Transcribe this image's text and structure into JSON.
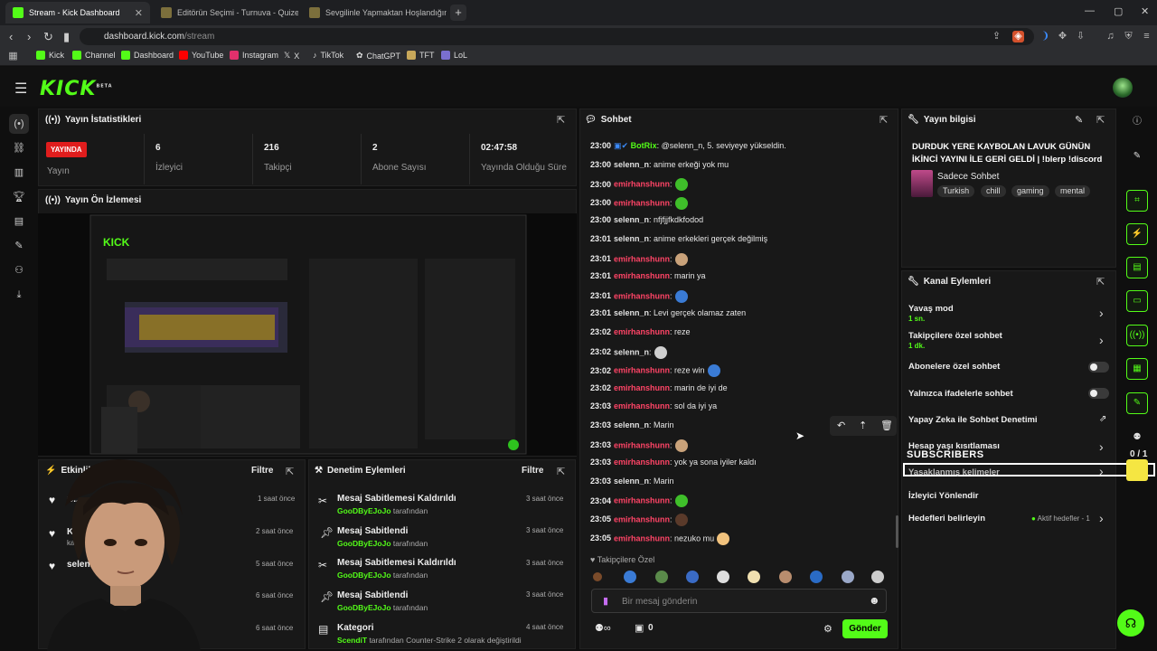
{
  "browser": {
    "tabs": [
      {
        "title": "Stream - Kick Dashboard",
        "active": true
      },
      {
        "title": "Editörün Seçimi - Turnuva - Quizei",
        "active": false
      },
      {
        "title": "Sevgilinle Yapmaktan Hoşlandığın Ş...",
        "active": false
      }
    ],
    "url_host": "dashboard.kick.com",
    "url_path": "/stream",
    "bookmarks": [
      "Kick",
      "Channel",
      "Dashboard",
      "YouTube",
      "Instagram",
      "X",
      "TikTok",
      "ChatGPT",
      "TFT",
      "LoL"
    ]
  },
  "app": {
    "logo": "KICK",
    "logo_badge": "BETA"
  },
  "stats": {
    "title": "Yayın İstatistikleri",
    "live_badge": "YAYINDA",
    "live_label": "Yayın",
    "items": [
      {
        "value": "6",
        "label": "İzleyici"
      },
      {
        "value": "216",
        "label": "Takipçi"
      },
      {
        "value": "2",
        "label": "Abone Sayısı"
      },
      {
        "value": "02:47:58",
        "label": "Yayında Olduğu Süre"
      }
    ]
  },
  "preview": {
    "title": "Yayın Ön İzlemesi"
  },
  "activity": {
    "title": "Etkinlik...",
    "filter": "Filtre",
    "rows": [
      {
        "name": "C...",
        "time": "1 saat önce"
      },
      {
        "name": "Ka...",
        "sub": "kana...",
        "time": "2 saat önce"
      },
      {
        "name": "selen...",
        "time": "5 saat önce"
      },
      {
        "name": "",
        "time": "6 saat önce"
      },
      {
        "name": "",
        "time": "6 saat önce"
      }
    ]
  },
  "moderation": {
    "title": "Denetim Eylemleri",
    "filter": "Filtre",
    "rows": [
      {
        "title": "Mesaj Sabitlemesi Kaldırıldı",
        "user": "GooDByEJoJo",
        "suffix": "tarafından",
        "time": "3 saat önce",
        "icon": "unpin-icon"
      },
      {
        "title": "Mesaj Sabitlendi",
        "user": "GooDByEJoJo",
        "suffix": "tarafından",
        "time": "3 saat önce",
        "icon": "pin-icon"
      },
      {
        "title": "Mesaj Sabitlemesi Kaldırıldı",
        "user": "GooDByEJoJo",
        "suffix": "tarafından",
        "time": "3 saat önce",
        "icon": "unpin-icon"
      },
      {
        "title": "Mesaj Sabitlendi",
        "user": "GooDByEJoJo",
        "suffix": "tarafından",
        "time": "3 saat önce",
        "icon": "pin-icon"
      },
      {
        "title": "Kategori",
        "user": "ScendiT",
        "suffix": "tarafından Counter-Strike 2 olarak değiştirildi",
        "time": "4 saat önce",
        "icon": "category-icon"
      }
    ]
  },
  "chat": {
    "title": "Sohbet",
    "messages": [
      {
        "ts": "23:00",
        "user": "BotRix",
        "cls": "u3",
        "text": ": @selenn_n, 5. seviyeye yükseldin."
      },
      {
        "ts": "23:00",
        "user": "selenn_n",
        "cls": "u1",
        "text": ": anime erkeği yok mu"
      },
      {
        "ts": "23:00",
        "user": "emirhanshunn",
        "cls": "u2",
        "text": ":",
        "emote": "#3fbf2a"
      },
      {
        "ts": "23:00",
        "user": "emirhanshunn",
        "cls": "u2",
        "text": ":",
        "emote": "#3fbf2a"
      },
      {
        "ts": "23:00",
        "user": "selenn_n",
        "cls": "u1",
        "text": ": nfjfjjfkdkfodod"
      },
      {
        "ts": "23:01",
        "user": "selenn_n",
        "cls": "u1",
        "text": ": anime erkekleri gerçek değilmiş"
      },
      {
        "ts": "23:01",
        "user": "emirhanshunn",
        "cls": "u2",
        "text": ":",
        "emote": "#c9a27a"
      },
      {
        "ts": "23:01",
        "user": "emirhanshunn",
        "cls": "u2",
        "text": ": marin ya"
      },
      {
        "ts": "23:01",
        "user": "emirhanshunn",
        "cls": "u2",
        "text": ":",
        "emote": "#3a7bd5"
      },
      {
        "ts": "23:01",
        "user": "selenn_n",
        "cls": "u1",
        "text": ": Levi gerçek olamaz zaten"
      },
      {
        "ts": "23:02",
        "user": "emirhanshunn",
        "cls": "u2",
        "text": ": reze"
      },
      {
        "ts": "23:02",
        "user": "selenn_n",
        "cls": "u1",
        "text": ":",
        "emote": "#cfcfcf"
      },
      {
        "ts": "23:02",
        "user": "emirhanshunn",
        "cls": "u2",
        "text": ": reze win",
        "emote": "#3a7bd5"
      },
      {
        "ts": "23:02",
        "user": "emirhanshunn",
        "cls": "u2",
        "text": ": marin de iyi de"
      },
      {
        "ts": "23:03",
        "user": "emirhanshunn",
        "cls": "u2",
        "text": ": sol da iyi ya"
      },
      {
        "ts": "23:03",
        "user": "selenn_n",
        "cls": "u1",
        "text": ": Marin"
      },
      {
        "ts": "23:03",
        "user": "emirhanshunn",
        "cls": "u2",
        "text": ":",
        "emote": "#c9a27a"
      },
      {
        "ts": "23:03",
        "user": "emirhanshunn",
        "cls": "u2",
        "text": ": yok ya sona iyiler kaldı"
      },
      {
        "ts": "23:03",
        "user": "selenn_n",
        "cls": "u1",
        "text": ": Marin"
      },
      {
        "ts": "23:04",
        "user": "emirhanshunn",
        "cls": "u2",
        "text": ":",
        "emote": "#3fbf2a"
      },
      {
        "ts": "23:05",
        "user": "emirhanshunn",
        "cls": "u2",
        "text": ":",
        "emote": "#5a3a2a"
      },
      {
        "ts": "23:05",
        "user": "emirhanshunn",
        "cls": "u2",
        "text": ": nezuko mu",
        "emote": "#f1c27d"
      }
    ],
    "followers_label": "Takipçilere Özel",
    "input_placeholder": "Bir mesaj gönderin",
    "send_label": "Gönder",
    "count": "0"
  },
  "stream_info": {
    "title": "Yayın bilgisi",
    "stream_title": "DURDUK YERE KAYBOLAN LAVUK GÜNÜN İKİNCİ YAYINI İLE GERİ GELDİ | !blerp !discord",
    "category": "Sadece Sohbet",
    "tags": [
      "Turkish",
      "chill",
      "gaming",
      "mental"
    ]
  },
  "channel_actions": {
    "title": "Kanal Eylemleri",
    "items": [
      {
        "label": "Yavaş mod",
        "sub": "1 sn.",
        "type": "chevron"
      },
      {
        "label": "Takipçilere özel sohbet",
        "sub": "1 dk.",
        "type": "chevron"
      },
      {
        "label": "Abonelere özel sohbet",
        "type": "toggle"
      },
      {
        "label": "Yalnızca ifadelerle sohbet",
        "type": "toggle"
      },
      {
        "label": "Yapay Zeka ile Sohbet Denetimi",
        "type": "external"
      },
      {
        "label": "Hesap yaşı kısıtlaması",
        "type": "chevron"
      },
      {
        "label": "Yasaklanmış kelimeler",
        "type": "chevron"
      },
      {
        "label": "İzleyici Yönlendir",
        "type": "none"
      },
      {
        "label": "Hedefleri belirleyin",
        "status": "Aktif hedefler - 1",
        "type": "chevron"
      }
    ],
    "overlay_label": "SUBSCRIBERS",
    "overlay_count": "0 / 1"
  }
}
